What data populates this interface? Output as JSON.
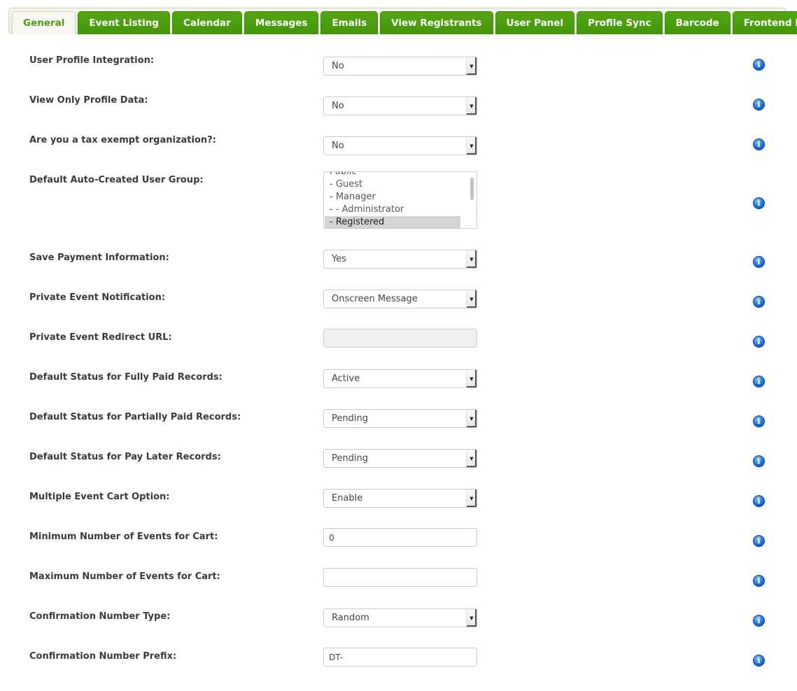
{
  "tabs": [
    {
      "label": "General",
      "active": true
    },
    {
      "label": "Event Listing"
    },
    {
      "label": "Calendar"
    },
    {
      "label": "Messages"
    },
    {
      "label": "Emails"
    },
    {
      "label": "View Registrants"
    },
    {
      "label": "User Panel"
    },
    {
      "label": "Profile Sync"
    },
    {
      "label": "Barcode"
    },
    {
      "label": "Frontend Mgmt"
    }
  ],
  "icons": {
    "info": "info-icon",
    "dropdown": "chevron-down-icon"
  },
  "colors": {
    "tab_green": "#4a9c0d",
    "active_tab_text": "#4f9b13",
    "info_blue": "#1a6fd8"
  },
  "fields": {
    "user_profile_integration": {
      "label": "User Profile Integration:",
      "value": "No"
    },
    "view_only_profile_data": {
      "label": "View Only Profile Data:",
      "value": "No"
    },
    "tax_exempt": {
      "label": "Are you a tax exempt organization?:",
      "value": "No"
    },
    "default_user_group": {
      "label": "Default Auto-Created User Group:",
      "options": [
        "Public",
        "- Guest",
        "- Manager",
        "- - Administrator",
        "- Registered"
      ],
      "selected": "- Registered"
    },
    "save_payment_info": {
      "label": "Save Payment Information:",
      "value": "Yes"
    },
    "private_event_notification": {
      "label": "Private Event Notification:",
      "value": "Onscreen Message"
    },
    "private_event_redirect_url": {
      "label": "Private Event Redirect URL:",
      "value": ""
    },
    "status_fully_paid": {
      "label": "Default Status for Fully Paid Records:",
      "value": "Active"
    },
    "status_partially_paid": {
      "label": "Default Status for Partially Paid Records:",
      "value": "Pending"
    },
    "status_pay_later": {
      "label": "Default Status for Pay Later Records:",
      "value": "Pending"
    },
    "multiple_event_cart": {
      "label": "Multiple Event Cart Option:",
      "value": "Enable"
    },
    "min_events_cart": {
      "label": "Minimum Number of Events for Cart:",
      "value": "0"
    },
    "max_events_cart": {
      "label": "Maximum Number of Events for Cart:",
      "value": ""
    },
    "confirmation_number_type": {
      "label": "Confirmation Number Type:",
      "value": "Random"
    },
    "confirmation_number_prefix": {
      "label": "Confirmation Number Prefix:",
      "value": "DT-"
    }
  }
}
